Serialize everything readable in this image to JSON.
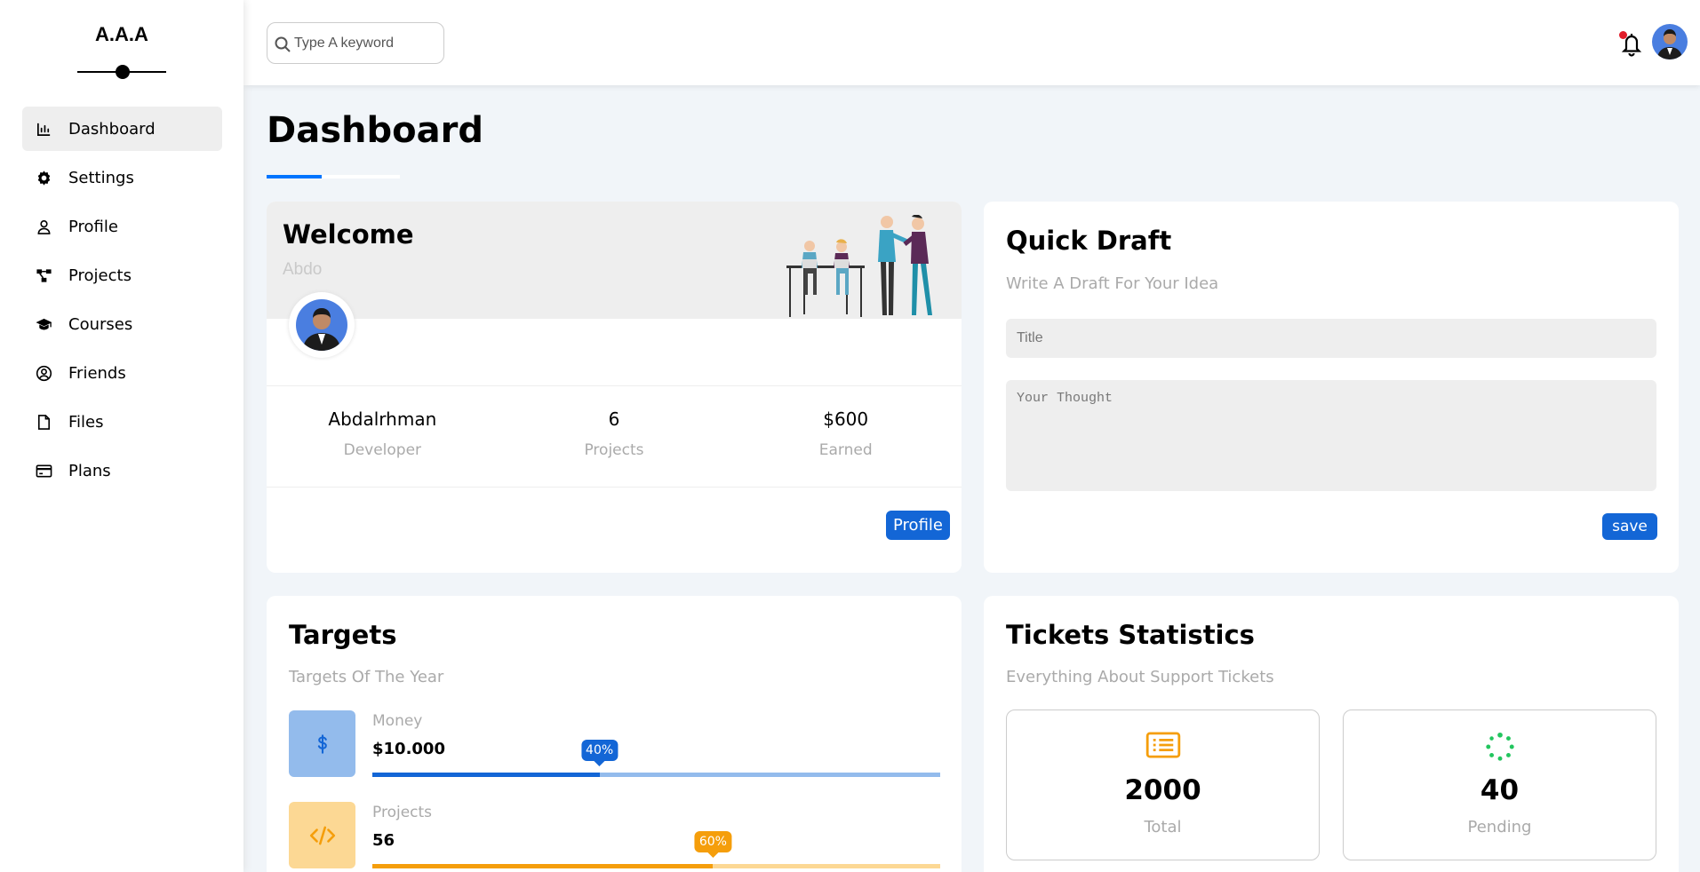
{
  "sidebar": {
    "logo": "A.A.A",
    "items": [
      {
        "label": "Dashboard",
        "icon": "chart-icon",
        "active": true
      },
      {
        "label": "Settings",
        "icon": "gear-icon"
      },
      {
        "label": "Profile",
        "icon": "user-icon"
      },
      {
        "label": "Projects",
        "icon": "diagram-icon"
      },
      {
        "label": "Courses",
        "icon": "graduation-cap-icon"
      },
      {
        "label": "Friends",
        "icon": "user-circle-icon"
      },
      {
        "label": "Files",
        "icon": "file-icon"
      },
      {
        "label": "Plans",
        "icon": "credit-card-icon"
      }
    ]
  },
  "header": {
    "search_placeholder": "Type A keyword",
    "notification_icon": "bell-icon",
    "has_notification": true
  },
  "page": {
    "title": "Dashboard"
  },
  "welcome": {
    "title": "Welcome",
    "name": "Abdo",
    "stats": [
      {
        "value": "Abdalrhman",
        "label": "Developer"
      },
      {
        "value": "6",
        "label": "Projects"
      },
      {
        "value": "$600",
        "label": "Earned"
      }
    ],
    "button": "Profile"
  },
  "draft": {
    "title": "Quick Draft",
    "subtitle": "Write A Draft For Your Idea",
    "title_placeholder": "Title",
    "thought_placeholder": "Your Thought",
    "button": "save"
  },
  "targets": {
    "title": "Targets",
    "subtitle": "Targets Of The Year",
    "items": [
      {
        "label": "Money",
        "value": "$10.000",
        "percent_label": "40%",
        "percent": 40,
        "icon": "dollar-icon",
        "color": "#1366d6",
        "light": "#93bbec"
      },
      {
        "label": "Projects",
        "value": "56",
        "percent_label": "60%",
        "percent": 60,
        "icon": "code-icon",
        "color": "#f59e0b",
        "light": "#fcd894"
      }
    ]
  },
  "tickets": {
    "title": "Tickets Statistics",
    "subtitle": "Everything About Support Tickets",
    "items": [
      {
        "value": "2000",
        "label": "Total",
        "icon": "list-icon",
        "color": "#f59e0b"
      },
      {
        "value": "40",
        "label": "Pending",
        "icon": "spinner-icon",
        "color": "#22c55e"
      }
    ]
  },
  "colors": {
    "accent": "#1366d6",
    "background": "#f1f5f9",
    "orange": "#f59e0b",
    "green": "#22c55e"
  }
}
